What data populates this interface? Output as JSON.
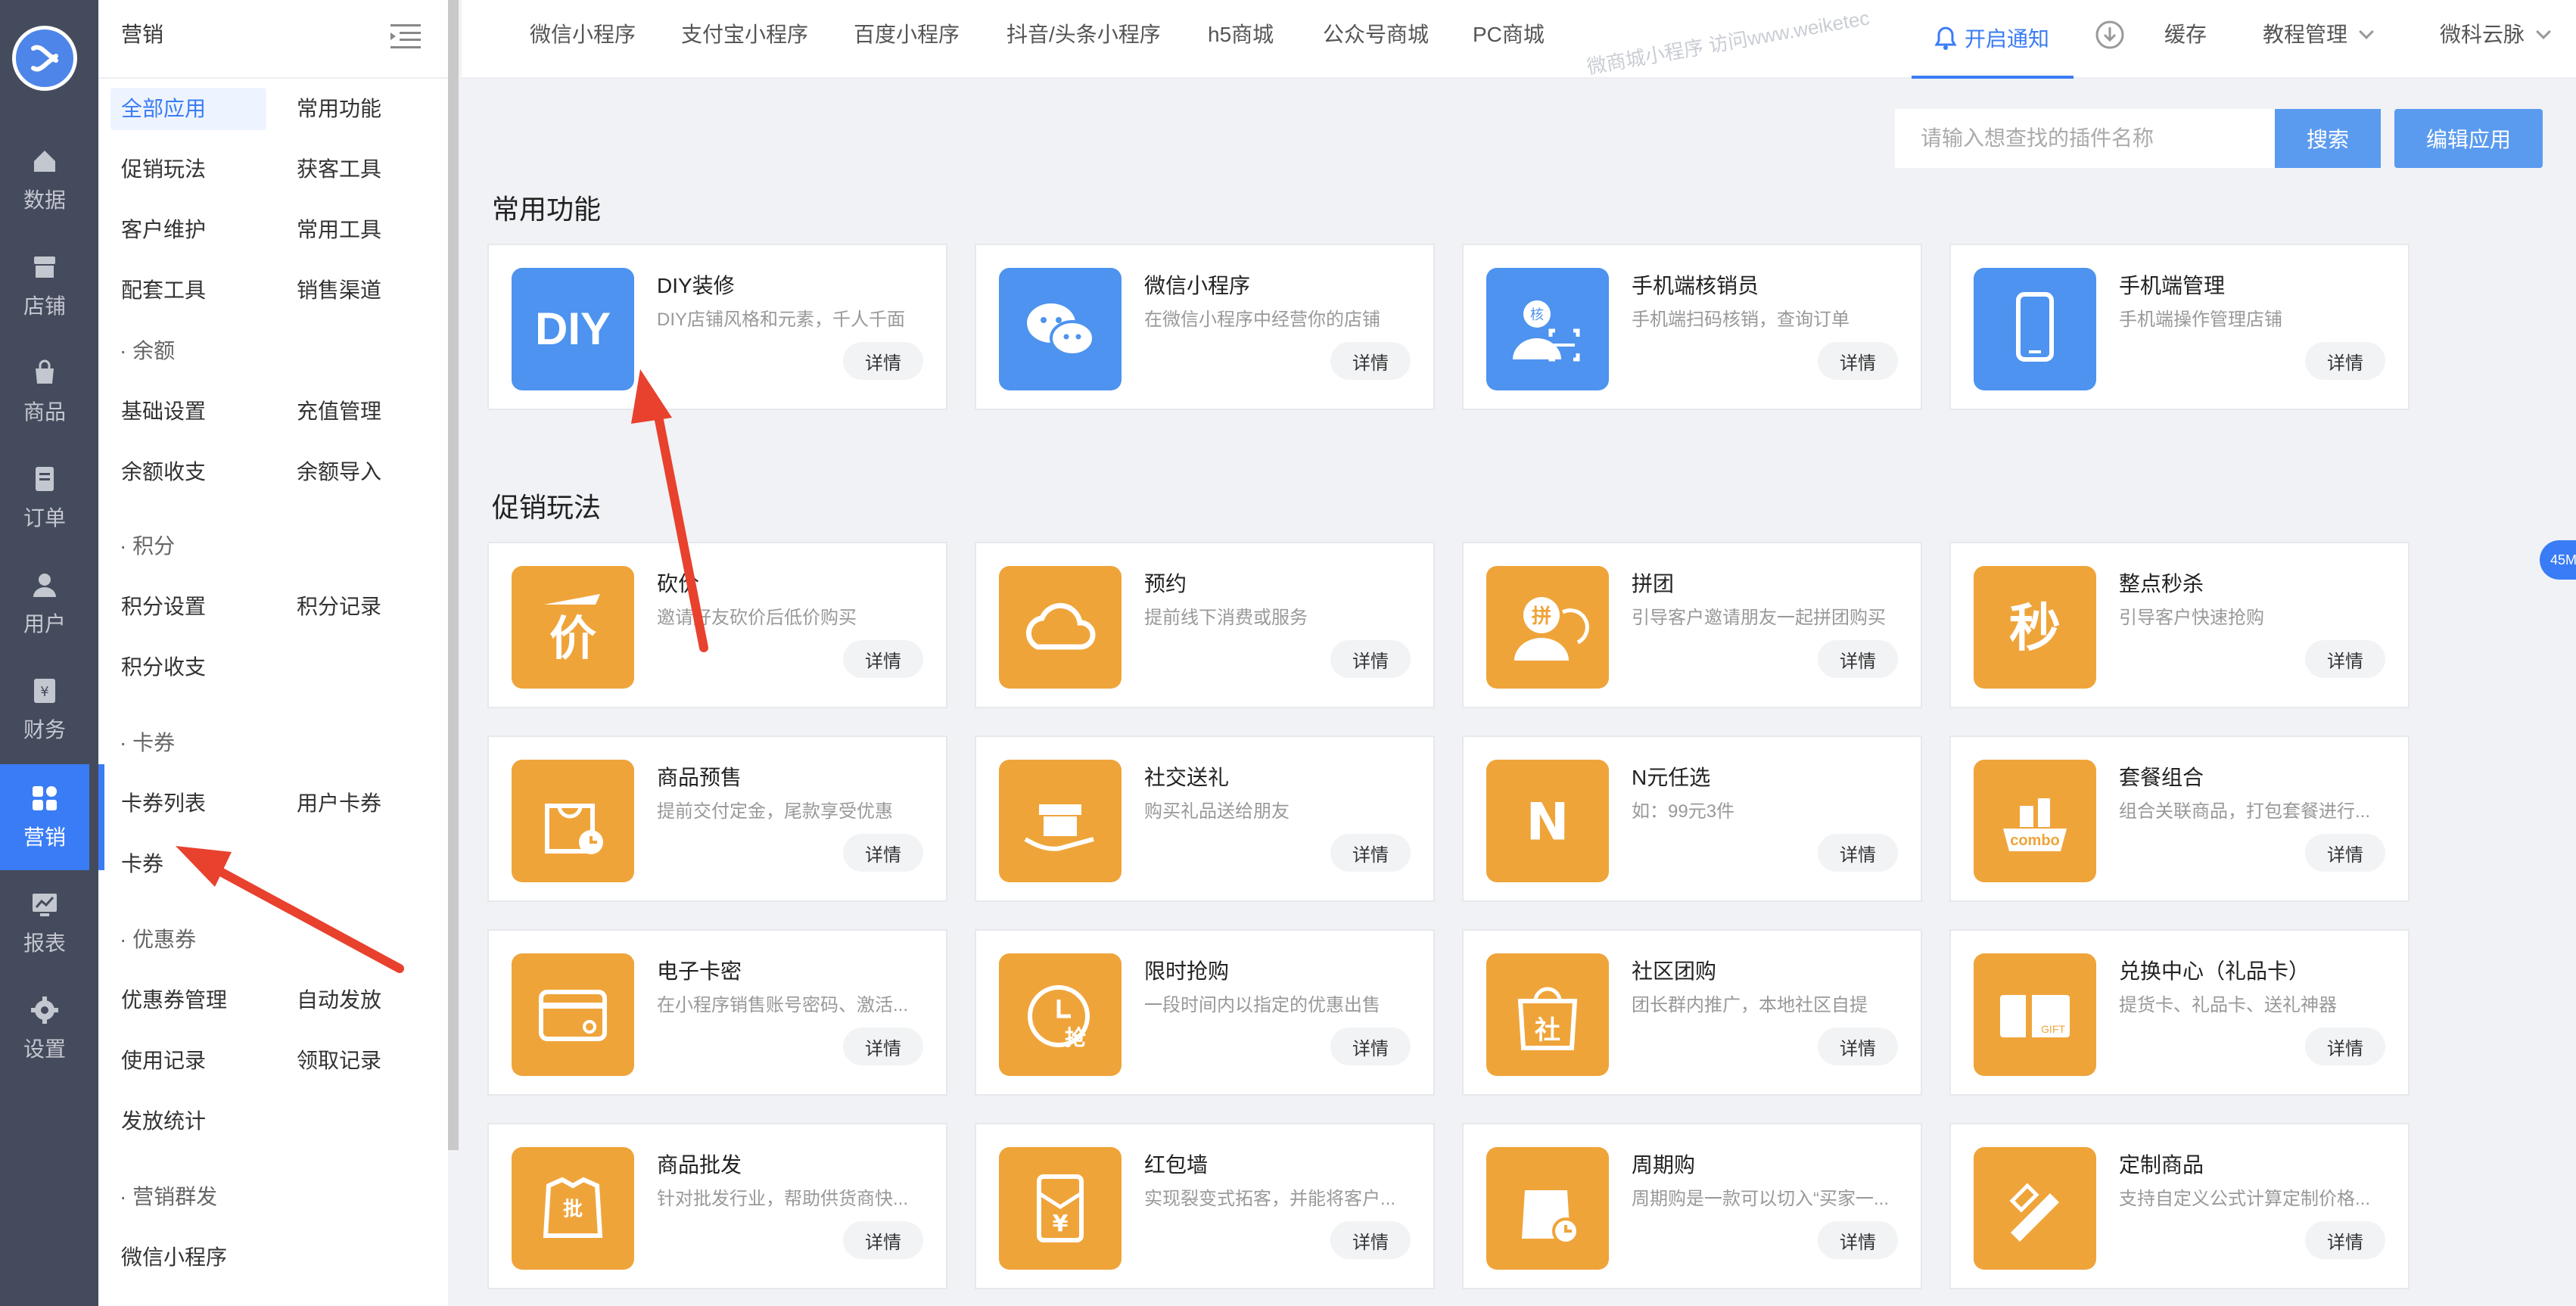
{
  "rail": {
    "items": [
      {
        "label": "数据",
        "icon": "home-icon"
      },
      {
        "label": "店铺",
        "icon": "store-icon"
      },
      {
        "label": "商品",
        "icon": "bag-icon"
      },
      {
        "label": "订单",
        "icon": "order-icon"
      },
      {
        "label": "用户",
        "icon": "user-icon"
      },
      {
        "label": "财务",
        "icon": "finance-icon"
      },
      {
        "label": "营销",
        "icon": "apps-icon"
      },
      {
        "label": "报表",
        "icon": "chart-icon"
      },
      {
        "label": "设置",
        "icon": "gear-icon"
      }
    ]
  },
  "sidebar": {
    "title": "营销",
    "items": [
      "全部应用",
      "常用功能",
      "促销玩法",
      "获客工具",
      "客户维护",
      "常用工具",
      "配套工具",
      "销售渠道",
      "基础设置",
      "充值管理",
      "余额收支",
      "余额导入",
      "积分设置",
      "积分记录",
      "积分收支",
      "卡券列表",
      "用户卡券",
      "卡券",
      "优惠券管理",
      "自动发放",
      "使用记录",
      "领取记录",
      "发放统计",
      "微信小程序"
    ],
    "groups": [
      "· 余额",
      "· 积分",
      "· 卡券",
      "· 优惠券",
      "· 营销群发"
    ]
  },
  "topnav": {
    "tabs": [
      "微信小程序",
      "支付宝小程序",
      "百度小程序",
      "抖音/头条小程序",
      "h5商城",
      "公众号商城",
      "PC商城"
    ],
    "watermark": "微商城小程序 访问www.weiketec",
    "notify": "开启通知",
    "cache": "缓存",
    "tutorial": "教程管理",
    "account": "微科云脉"
  },
  "search": {
    "placeholder": "请输入想查找的插件名称",
    "button": "搜索",
    "edit": "编辑应用"
  },
  "sections": {
    "common": "常用功能",
    "promo": "促销玩法"
  },
  "detail_label": "详情",
  "common_cards": [
    {
      "name": "DIY装修",
      "desc": "DIY店铺风格和元素，千人千面",
      "icon": "diy-icon"
    },
    {
      "name": "微信小程序",
      "desc": "在微信小程序中经营你的店铺",
      "icon": "wechat-icon"
    },
    {
      "name": "手机端核销员",
      "desc": "手机端扫码核销，查询订单",
      "icon": "verify-icon"
    },
    {
      "name": "手机端管理",
      "desc": "手机端操作管理店铺",
      "icon": "phone-icon"
    }
  ],
  "promo_cards": [
    {
      "name": "砍价",
      "desc": "邀请好友砍价后低价购买",
      "icon": "bargain-icon",
      "glyph": "价"
    },
    {
      "name": "预约",
      "desc": "提前线下消费或服务",
      "icon": "cloud-icon"
    },
    {
      "name": "拼团",
      "desc": "引导客户邀请朋友一起拼团购买",
      "icon": "group-buy-icon",
      "glyph": "拼"
    },
    {
      "name": "整点秒杀",
      "desc": "引导客户快速抢购",
      "icon": "flash-sale-icon",
      "glyph": "秒"
    },
    {
      "name": "商品预售",
      "desc": "提前交付定金，尾款享受优惠",
      "icon": "presale-icon"
    },
    {
      "name": "社交送礼",
      "desc": "购买礼品送给朋友",
      "icon": "gift-icon"
    },
    {
      "name": "N元任选",
      "desc": "如：99元3件",
      "icon": "n-choice-icon",
      "glyph": "N"
    },
    {
      "name": "套餐组合",
      "desc": "组合关联商品，打包套餐进行...",
      "icon": "combo-icon",
      "glyph": "combo"
    },
    {
      "name": "电子卡密",
      "desc": "在小程序销售账号密码、激活...",
      "icon": "card-key-icon"
    },
    {
      "name": "限时抢购",
      "desc": "一段时间内以指定的优惠出售",
      "icon": "timed-sale-icon",
      "glyph": "抢"
    },
    {
      "name": "社区团购",
      "desc": "团长群内推广，本地社区自提",
      "icon": "community-icon",
      "glyph": "社"
    },
    {
      "name": "兑换中心（礼品卡）",
      "desc": "提货卡、礼品卡、送礼神器",
      "icon": "gift-card-icon",
      "glyph": "GIFT"
    },
    {
      "name": "商品批发",
      "desc": "针对批发行业，帮助供货商快...",
      "icon": "wholesale-icon",
      "glyph": "批"
    },
    {
      "name": "红包墙",
      "desc": "实现裂变式拓客，并能将客户...",
      "icon": "red-packet-icon",
      "glyph": "¥"
    },
    {
      "name": "周期购",
      "desc": "周期购是一款可以切入“买家一...",
      "icon": "periodic-icon"
    },
    {
      "name": "定制商品",
      "desc": "支持自定义公式计算定制价格...",
      "icon": "custom-icon"
    }
  ],
  "float_badge": "45M",
  "colors": {
    "accent": "#3a7cf5",
    "orange": "#efa43a",
    "blue_icon": "#4d93ef",
    "annotation": "#e8412e"
  }
}
